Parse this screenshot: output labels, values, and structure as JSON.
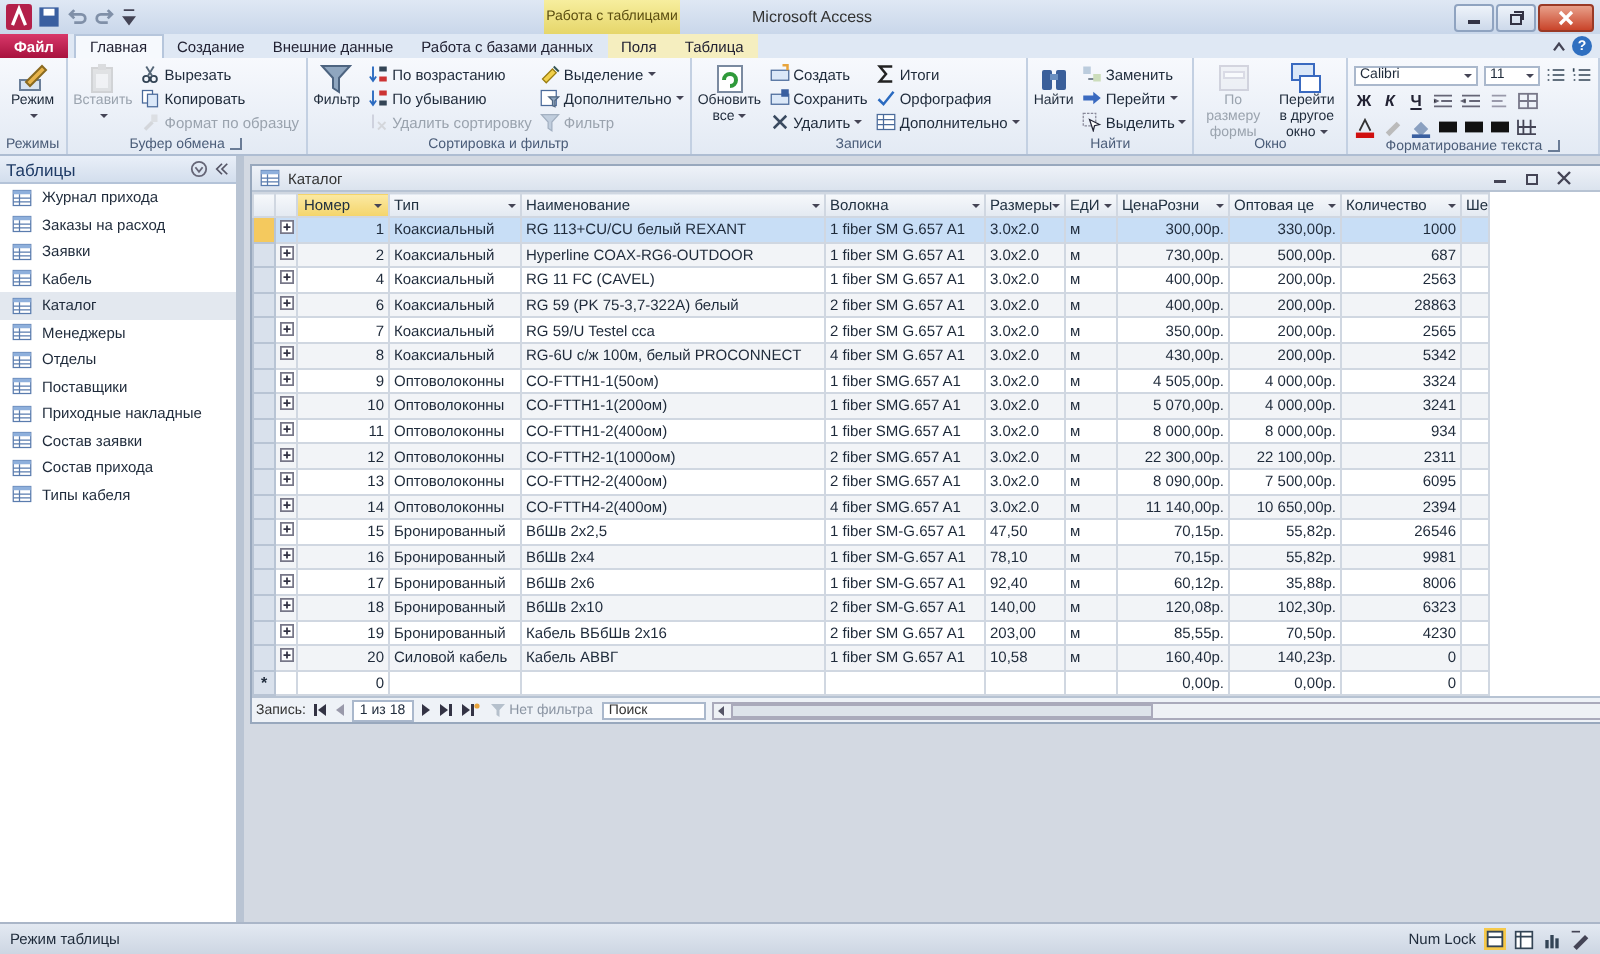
{
  "window": {
    "title": "Microsoft Access",
    "context_group": "Работа с таблицами",
    "help": "?"
  },
  "ribbon_tabs": [
    {
      "label": "Файл",
      "kind": "file",
      "selected": false
    },
    {
      "label": "Главная",
      "kind": "normal",
      "selected": true
    },
    {
      "label": "Создание",
      "kind": "normal",
      "selected": false
    },
    {
      "label": "Внешние данные",
      "kind": "normal",
      "selected": false
    },
    {
      "label": "Работа с базами данных",
      "kind": "normal",
      "selected": false
    },
    {
      "label": "Поля",
      "kind": "context",
      "selected": false
    },
    {
      "label": "Таблица",
      "kind": "context",
      "selected": false
    }
  ],
  "ribbon_groups": [
    {
      "label": "Режимы",
      "kind": "buttons",
      "launcher": false,
      "items": [
        {
          "kind": "large",
          "label": "Режим",
          "dropdown": true,
          "disabled": false
        }
      ]
    },
    {
      "label": "Буфер обмена",
      "kind": "buttons",
      "launcher": true,
      "items": [
        {
          "kind": "large",
          "label": "Вставить",
          "dropdown": true,
          "disabled": true
        },
        {
          "kind": "small",
          "label": "Вырезать",
          "dropdown": false,
          "disabled": false
        },
        {
          "kind": "small",
          "label": "Копировать",
          "dropdown": false,
          "disabled": false
        },
        {
          "kind": "small",
          "label": "Формат по образцу",
          "dropdown": false,
          "disabled": true
        }
      ]
    },
    {
      "label": "Сортировка и фильтр",
      "kind": "buttons",
      "launcher": false,
      "items": [
        {
          "kind": "large",
          "label": "Фильтр",
          "dropdown": false,
          "disabled": false
        },
        {
          "kind": "small",
          "label": "По возрастанию",
          "dropdown": false,
          "disabled": false
        },
        {
          "kind": "small",
          "label": "По убыванию",
          "dropdown": false,
          "disabled": false
        },
        {
          "kind": "small",
          "label": "Удалить сортировку",
          "dropdown": false,
          "disabled": true
        },
        {
          "kind": "small",
          "label": "Выделение",
          "dropdown": true,
          "disabled": false
        },
        {
          "kind": "small",
          "label": "Дополнительно",
          "dropdown": true,
          "disabled": false
        },
        {
          "kind": "small",
          "label": "Фильтр",
          "dropdown": false,
          "disabled": true
        }
      ]
    },
    {
      "label": "Записи",
      "kind": "buttons",
      "launcher": false,
      "items": [
        {
          "kind": "large",
          "label": "Обновить все",
          "dropdown": true,
          "disabled": false
        },
        {
          "kind": "small",
          "label": "Создать",
          "dropdown": false,
          "disabled": false
        },
        {
          "kind": "small",
          "label": "Сохранить",
          "dropdown": false,
          "disabled": false
        },
        {
          "kind": "small",
          "label": "Удалить",
          "dropdown": true,
          "disabled": false
        },
        {
          "kind": "small",
          "label": "Итоги",
          "dropdown": false,
          "disabled": false
        },
        {
          "kind": "small",
          "label": "Орфография",
          "dropdown": false,
          "disabled": false
        },
        {
          "kind": "small",
          "label": "Дополнительно",
          "dropdown": true,
          "disabled": false
        }
      ]
    },
    {
      "label": "Найти",
      "kind": "buttons",
      "launcher": false,
      "items": [
        {
          "kind": "large",
          "label": "Найти",
          "dropdown": false,
          "disabled": false
        },
        {
          "kind": "small",
          "label": "Заменить",
          "dropdown": false,
          "disabled": false
        },
        {
          "kind": "small",
          "label": "Перейти",
          "dropdown": true,
          "disabled": false
        },
        {
          "kind": "small",
          "label": "Выделить",
          "dropdown": true,
          "disabled": false
        }
      ]
    },
    {
      "label": "Окно",
      "kind": "buttons",
      "launcher": false,
      "items": [
        {
          "kind": "large",
          "label": "По размеру формы",
          "dropdown": false,
          "disabled": true
        },
        {
          "kind": "large",
          "label": "Перейти в другое окно",
          "dropdown": true,
          "disabled": false
        }
      ]
    },
    {
      "label": "Форматирование текста",
      "kind": "font",
      "launcher": true,
      "font_name": "Calibri",
      "font_size": "11",
      "style_buttons": [
        "Ж",
        "К",
        "Ч"
      ]
    }
  ],
  "navigation": {
    "title": "Таблицы",
    "items": [
      {
        "label": "Журнал прихода",
        "selected": false
      },
      {
        "label": "Заказы на расход",
        "selected": false
      },
      {
        "label": "Заявки",
        "selected": false
      },
      {
        "label": "Кабель",
        "selected": false
      },
      {
        "label": "Каталог",
        "selected": true
      },
      {
        "label": "Менеджеры",
        "selected": false
      },
      {
        "label": "Отделы",
        "selected": false
      },
      {
        "label": "Поставщики",
        "selected": false
      },
      {
        "label": "Приходные накладные",
        "selected": false
      },
      {
        "label": "Состав заявки",
        "selected": false
      },
      {
        "label": "Состав прихода",
        "selected": false
      },
      {
        "label": "Типы кабеля",
        "selected": false
      }
    ]
  },
  "datasheet": {
    "title": "Каталог",
    "columns": [
      {
        "label": "Номер",
        "selected": true
      },
      {
        "label": "Тип",
        "selected": false
      },
      {
        "label": "Наименование",
        "selected": false
      },
      {
        "label": "Волокна",
        "selected": false
      },
      {
        "label": "Размеры",
        "selected": false
      },
      {
        "label": "ЕдИ",
        "selected": false
      },
      {
        "label": "ЦенаРозни",
        "selected": false
      },
      {
        "label": "Оптовая це",
        "selected": false
      },
      {
        "label": "Количество",
        "selected": false
      },
      {
        "label": "Ше",
        "selected": false
      }
    ],
    "rows": [
      {
        "kind": "record",
        "selected": true,
        "cells": [
          "1",
          "Коаксиальный",
          "RG 113+CU/CU белый REXANT",
          "1 fiber SM G.657 A1",
          "3.0x2.0",
          "м",
          "300,00р.",
          "330,00р.",
          "1000"
        ]
      },
      {
        "kind": "record",
        "selected": false,
        "cells": [
          "2",
          "Коаксиальный",
          "Hyperline COAX-RG6-OUTDOOR",
          "1 fiber SM G.657 A1",
          "3.0x2.0",
          "м",
          "730,00р.",
          "500,00р.",
          "687"
        ]
      },
      {
        "kind": "record",
        "selected": false,
        "cells": [
          "4",
          "Коаксиальный",
          "RG 11 FC (CAVEL)",
          "1 fiber SM G.657 A1",
          "3.0x2.0",
          "м",
          "400,00р.",
          "200,00р.",
          "2563"
        ]
      },
      {
        "kind": "record",
        "selected": false,
        "cells": [
          "6",
          "Коаксиальный",
          "RG 59 (PK 75-3,7-322А) белый",
          "2 fiber SM G.657 A1",
          "3.0x2.0",
          "м",
          "400,00р.",
          "200,00р.",
          "28863"
        ]
      },
      {
        "kind": "record",
        "selected": false,
        "cells": [
          "7",
          "Коаксиальный",
          "RG 59/U Testel cca",
          "2 fiber SM G.657 A1",
          "3.0x2.0",
          "м",
          "350,00р.",
          "200,00р.",
          "2565"
        ]
      },
      {
        "kind": "record",
        "selected": false,
        "cells": [
          "8",
          "Коаксиальный",
          "RG-6U с/ж 100м, белый PROCONNECT",
          "4 fiber SM G.657 A1",
          "3.0x2.0",
          "м",
          "430,00р.",
          "200,00р.",
          "5342"
        ]
      },
      {
        "kind": "record",
        "selected": false,
        "cells": [
          "9",
          "Оптоволоконны",
          "CO-FTTH1-1(50ом)",
          "1 fiber SMG.657 A1",
          "3.0x2.0",
          "м",
          "4 505,00р.",
          "4 000,00р.",
          "3324"
        ]
      },
      {
        "kind": "record",
        "selected": false,
        "cells": [
          "10",
          "Оптоволоконны",
          "CO-FTTH1-1(200ом)",
          "1 fiber SMG.657 A1",
          "3.0x2.0",
          "м",
          "5 070,00р.",
          "4 000,00р.",
          "3241"
        ]
      },
      {
        "kind": "record",
        "selected": false,
        "cells": [
          "11",
          "Оптоволоконны",
          "CO-FTTH1-2(400ом)",
          "1 fiber SMG.657 A1",
          "3.0x2.0",
          "м",
          "8 000,00р.",
          "8 000,00р.",
          "934"
        ]
      },
      {
        "kind": "record",
        "selected": false,
        "cells": [
          "12",
          "Оптоволоконны",
          "CO-FTTH2-1(1000ом)",
          "2 fiber SMG.657 A1",
          "3.0x2.0",
          "м",
          "22 300,00р.",
          "22 100,00р.",
          "2311"
        ]
      },
      {
        "kind": "record",
        "selected": false,
        "cells": [
          "13",
          "Оптоволоконны",
          "CO-FTTH2-2(400ом)",
          "2 fiber SMG.657 A1",
          "3.0x2.0",
          "м",
          "8 090,00р.",
          "7 500,00р.",
          "6095"
        ]
      },
      {
        "kind": "record",
        "selected": false,
        "cells": [
          "14",
          "Оптоволоконны",
          "CO-FTTH4-2(400ом)",
          "4 fiber SMG.657 A1",
          "3.0x2.0",
          "м",
          "11 140,00р.",
          "10 650,00р.",
          "2394"
        ]
      },
      {
        "kind": "record",
        "selected": false,
        "cells": [
          "15",
          "Бронированный",
          "ВбШв 2х2,5",
          "1 fiber SM-G.657 A1",
          "47,50",
          "м",
          "70,15р.",
          "55,82р.",
          "26546"
        ]
      },
      {
        "kind": "record",
        "selected": false,
        "cells": [
          "16",
          "Бронированный",
          "ВбШв 2х4",
          "1 fiber SM-G.657 A1",
          "78,10",
          "м",
          "70,15р.",
          "55,82р.",
          "9981"
        ]
      },
      {
        "kind": "record",
        "selected": false,
        "cells": [
          "17",
          "Бронированный",
          "ВбШв 2х6",
          "1 fiber SM-G.657 A1",
          "92,40",
          "м",
          "60,12р.",
          "35,88р.",
          "8006"
        ]
      },
      {
        "kind": "record",
        "selected": false,
        "cells": [
          "18",
          "Бронированный",
          "ВбШв 2х10",
          "2 fiber SM-G.657 A1",
          "140,00",
          "м",
          "120,08р.",
          "102,30р.",
          "6323"
        ]
      },
      {
        "kind": "record",
        "selected": false,
        "cells": [
          "19",
          "Бронированный",
          "Кабель ВБбШв 2х16",
          "2 fiber SM G.657 A1",
          "203,00",
          "м",
          "85,55р.",
          "70,50р.",
          "4230"
        ]
      },
      {
        "kind": "record",
        "selected": false,
        "cells": [
          "20",
          "Силовой кабель",
          "Кабель АВВГ",
          "1 fiber SM G.657 A1",
          "10,58",
          "м",
          "160,40р.",
          "140,23р.",
          "0"
        ]
      },
      {
        "kind": "new",
        "selected": false,
        "marker": "*",
        "cells": [
          "0",
          null,
          null,
          null,
          null,
          null,
          "0,00р.",
          "0,00р.",
          "0"
        ]
      }
    ]
  },
  "record_nav": {
    "label": "Запись:",
    "position": "1 из 18",
    "filter": "Нет фильтра",
    "search_placeholder": "Поиск"
  },
  "status_bar": {
    "text": "Режим таблицы",
    "num_lock": "Num Lock"
  }
}
